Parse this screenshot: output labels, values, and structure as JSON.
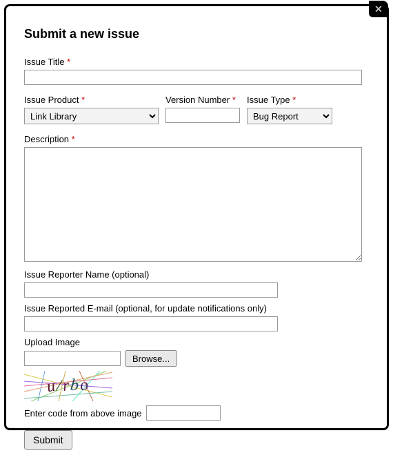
{
  "title": "Submit a new issue",
  "fields": {
    "issue_title": {
      "label": "Issue Title",
      "required": "*",
      "value": ""
    },
    "issue_product": {
      "label": "Issue Product",
      "required": "*",
      "value": "Link Library"
    },
    "version_number": {
      "label": "Version Number",
      "required": "*",
      "value": ""
    },
    "issue_type": {
      "label": "Issue Type",
      "required": "*",
      "value": "Bug Report"
    },
    "description": {
      "label": "Description",
      "required": "*",
      "value": ""
    },
    "reporter_name": {
      "label": "Issue Reporter Name (optional)",
      "value": ""
    },
    "reporter_email": {
      "label": "Issue Reported E-mail (optional, for update notifications only)",
      "value": ""
    },
    "upload_image": {
      "label": "Upload Image",
      "button": "Browse...",
      "value": ""
    },
    "captcha": {
      "label": "Enter code from above image",
      "image_text": "u/rbo",
      "value": ""
    }
  },
  "submit_label": "Submit",
  "close_label": "✕"
}
